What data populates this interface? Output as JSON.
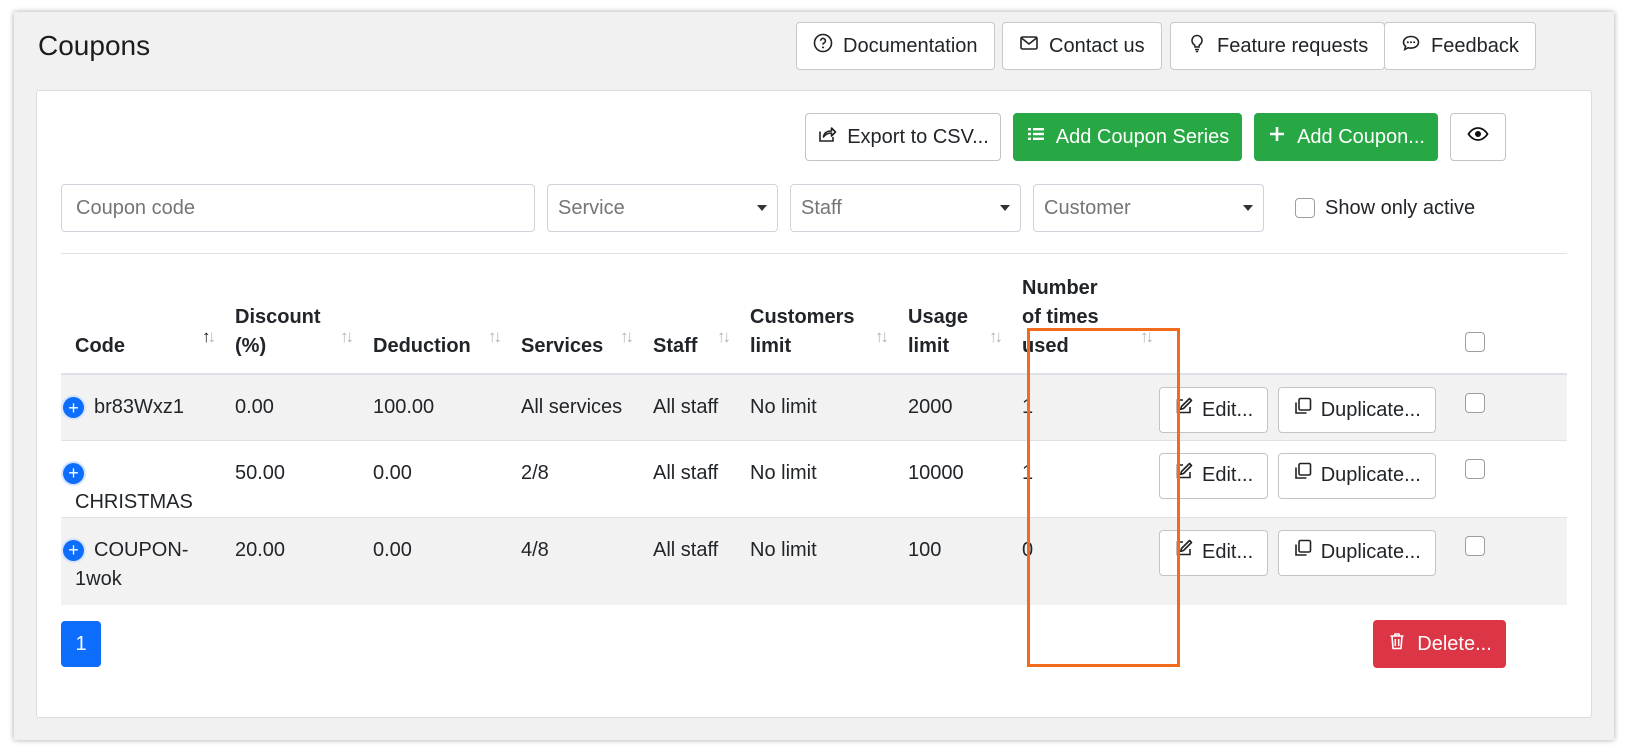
{
  "page": {
    "title": "Coupons"
  },
  "header_buttons": {
    "documentation": "Documentation",
    "contact": "Contact us",
    "feature": "Feature requests",
    "feedback": "Feedback"
  },
  "toolbar": {
    "export": "Export to CSV...",
    "add_series": "Add Coupon Series",
    "add_coupon": "Add Coupon..."
  },
  "filters": {
    "code_placeholder": "Coupon code",
    "service": "Service",
    "staff": "Staff",
    "customer": "Customer",
    "show_only_active": "Show only active"
  },
  "columns": {
    "code": "Code",
    "discount_1": "Discount",
    "discount_2": "(%)",
    "deduction": "Deduction",
    "services": "Services",
    "staff": "Staff",
    "customers_limit_1": "Customers",
    "customers_limit_2": "limit",
    "usage_limit_1": "Usage",
    "usage_limit_2": "limit",
    "times_used_1": "Number",
    "times_used_2": "of times",
    "times_used_3": "used"
  },
  "rows": [
    {
      "code": "br83Wxz1",
      "discount": "0.00",
      "deduction": "100.00",
      "services": "All services",
      "staff": "All staff",
      "customers_limit": "No limit",
      "usage_limit": "2000",
      "times_used": "1"
    },
    {
      "code": "CHRISTMAS",
      "discount": "50.00",
      "deduction": "0.00",
      "services": "2/8",
      "staff": "All staff",
      "customers_limit": "No limit",
      "usage_limit": "10000",
      "times_used": "1"
    },
    {
      "code": "COUPON-",
      "code_2": "1wok",
      "discount": "20.00",
      "deduction": "0.00",
      "services": "4/8",
      "staff": "All staff",
      "customers_limit": "No limit",
      "usage_limit": "100",
      "times_used": "0"
    }
  ],
  "row_actions": {
    "edit": "Edit...",
    "duplicate": "Duplicate..."
  },
  "footer": {
    "page": "1",
    "delete": "Delete..."
  },
  "colors": {
    "success": "#28a745",
    "danger": "#dc3545",
    "primary": "#0d6efd",
    "highlight": "#f26b1d"
  }
}
